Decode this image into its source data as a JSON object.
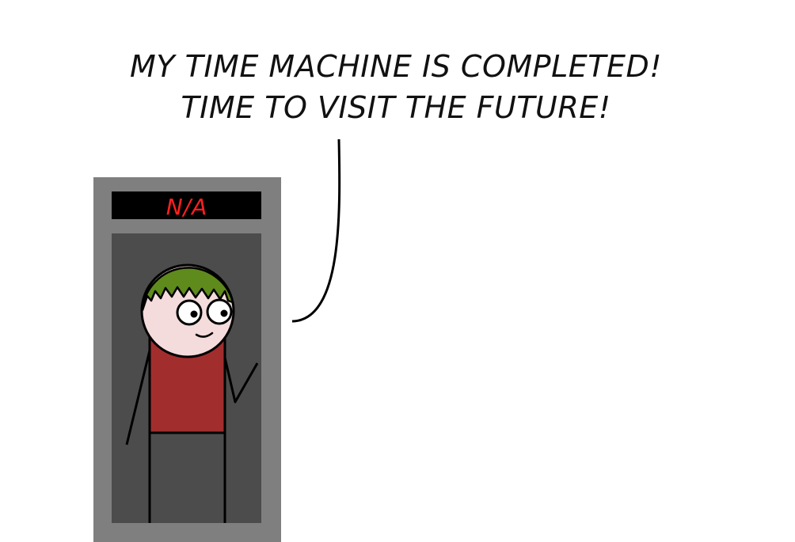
{
  "speech": {
    "line1": "MY TIME MACHINE IS COMPLETED!",
    "line2": "TIME TO VISIT THE FUTURE!"
  },
  "time_machine": {
    "display": "N/A"
  },
  "colors": {
    "booth_frame": "#7f7f7f",
    "booth_interior": "#4c4c4c",
    "display_background": "#000000",
    "display_text": "#ff2020",
    "hair": "#5f8a1c",
    "skin": "#f5dcdc",
    "shirt": "#a22d2d",
    "outline": "#000000"
  },
  "icons": {
    "character": "stick-figure",
    "device": "time-machine-booth"
  }
}
